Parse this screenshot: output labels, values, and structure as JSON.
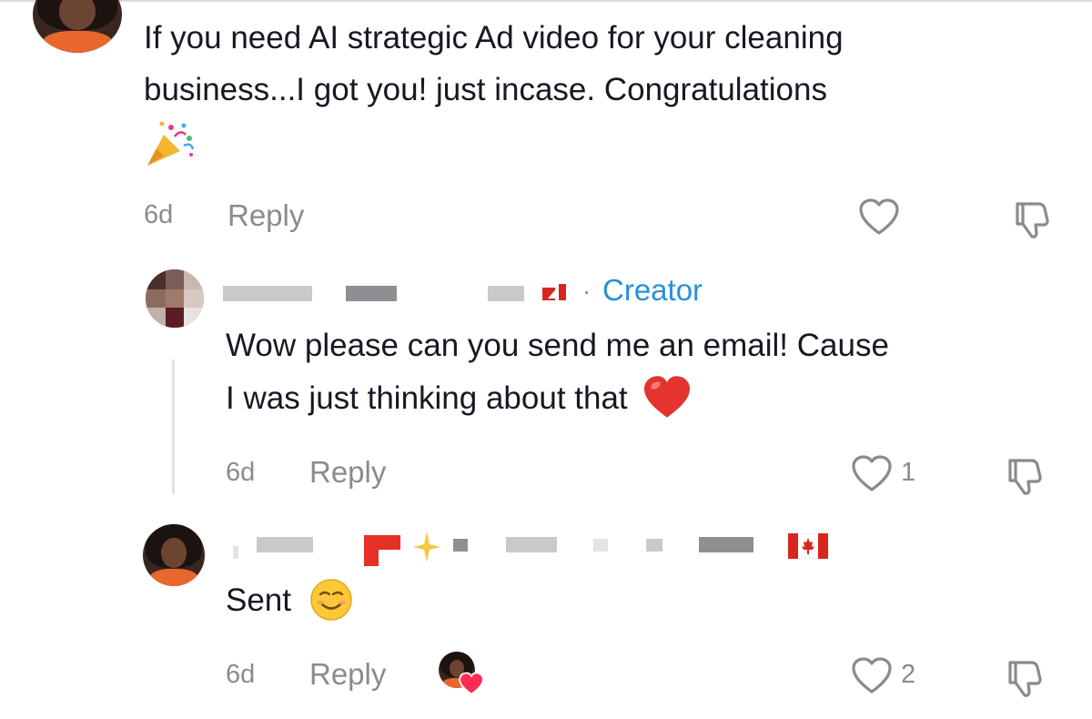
{
  "comments": [
    {
      "text_line1": "If you need AI strategic Ad video for your cleaning",
      "text_line2": "business...I got you! just incase. Congratulations",
      "emoji": "party-popper",
      "time": "6d",
      "reply_label": "Reply",
      "like_count": ""
    },
    {
      "badge": "Creator",
      "badge_separator": "·",
      "text_line1": "Wow please can you send me an email! Cause",
      "text_line2": "I was just thinking about that",
      "emoji": "red-heart",
      "time": "6d",
      "reply_label": "Reply",
      "like_count": "1"
    },
    {
      "text_line1": "Sent",
      "emoji": "smiling-face",
      "time": "6d",
      "reply_label": "Reply",
      "like_count": "2"
    }
  ],
  "colors": {
    "text": "#161823",
    "muted": "#8a8b91",
    "creator": "#2a8fd6",
    "heart": "#e3342f"
  },
  "icons": [
    "heart-outline-icon",
    "dislike-icon",
    "creator-liked-badge-icon"
  ]
}
